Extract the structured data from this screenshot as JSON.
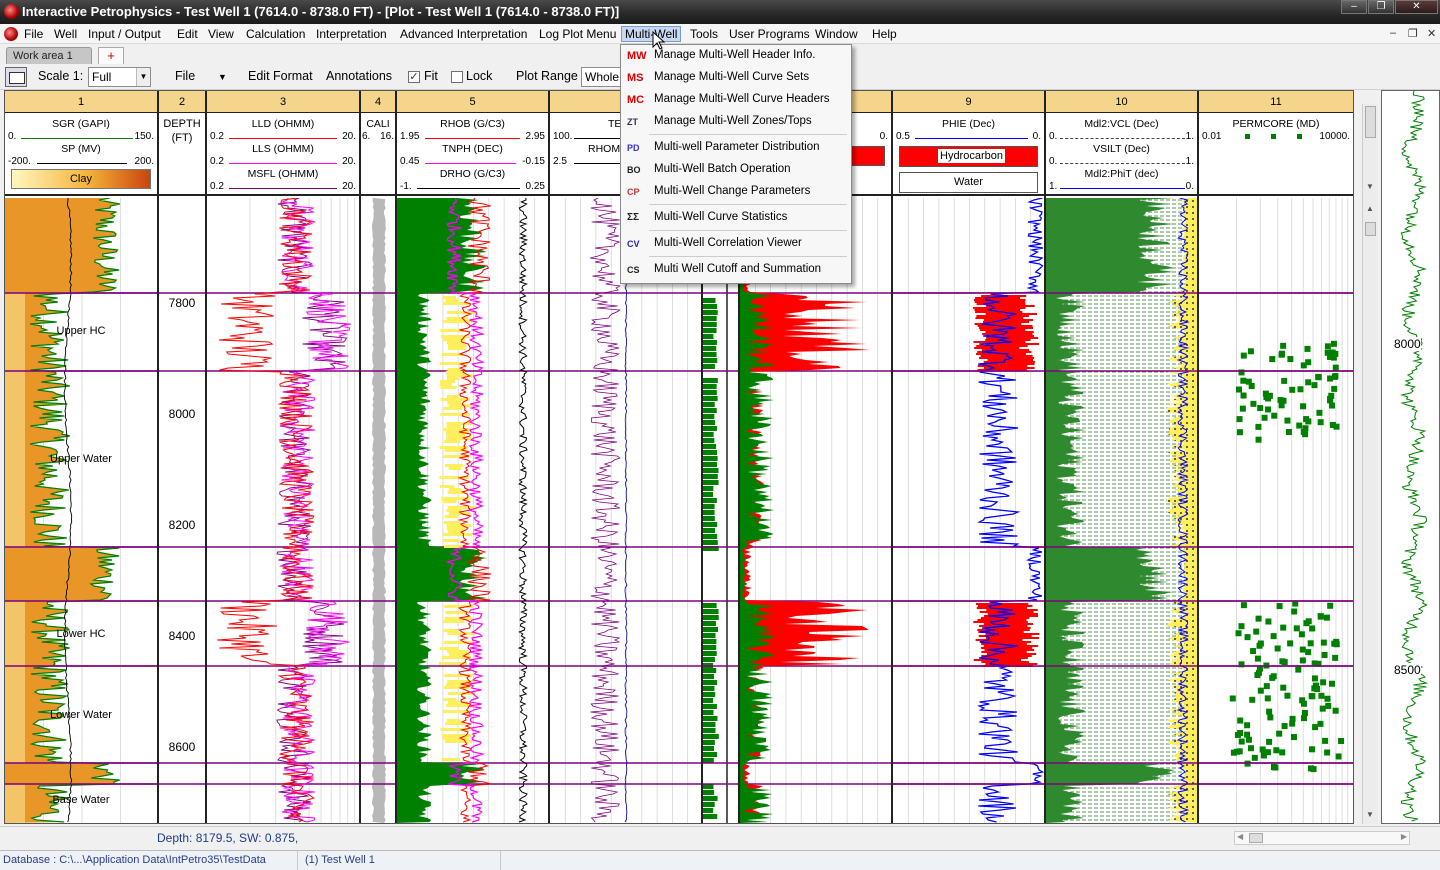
{
  "window": {
    "title": "Interactive Petrophysics  -  Test Well 1 (7614.0 - 8738.0 FT) - [Plot - Test Well 1 (7614.0 - 8738.0 FT)]"
  },
  "menubar": {
    "items": [
      "File",
      "Well",
      "Input / Output",
      "Edit",
      "View",
      "Calculation",
      "Interpretation",
      "Advanced Interpretation",
      "Log Plot Menu",
      "Multi-Well",
      "Tools",
      "User Programs",
      "Window",
      "Help"
    ],
    "active": "Multi-Well"
  },
  "tabs": {
    "work_area": "Work area 1",
    "add": "+"
  },
  "toolbar": {
    "scale_label": "Scale 1:",
    "scale_value": "Full",
    "file": "File",
    "edit_format": "Edit Format",
    "annotations": "Annotations",
    "fit": "Fit",
    "fit_checked": true,
    "lock": "Lock",
    "lock_checked": false,
    "plot_range": "Plot Range",
    "plot_range_value": "Whole"
  },
  "multiwell_menu": [
    {
      "icon": "MW",
      "label": "Manage Multi-Well Header Info."
    },
    {
      "icon": "MS",
      "label": "Manage Multi-Well Curve Sets"
    },
    {
      "icon": "MC",
      "label": "Manage Multi-Well Curve Headers"
    },
    {
      "icon": "ZT",
      "label": "Manage Multi-Well Zones/Tops"
    },
    {
      "icon": "PD",
      "label": "Multi-well Parameter Distribution"
    },
    {
      "icon": "BO",
      "label": "Multi-Well Batch Operation"
    },
    {
      "icon": "CP",
      "label": "Multi-Well Change Parameters"
    },
    {
      "icon": "ΣΣ",
      "label": "Multi-Well Curve Statistics"
    },
    {
      "icon": "CV",
      "label": "Multi-Well Correlation Viewer"
    },
    {
      "icon": "CS",
      "label": "Multi Well Cutoff and Summation"
    }
  ],
  "tracks": {
    "t1": {
      "num": "1",
      "c1": "SGR (GAPI)",
      "c1_min": "0.",
      "c1_max": "150.",
      "c2": "SP (MV)",
      "c2_min": "-200.",
      "c2_max": "200.",
      "fill": "Clay"
    },
    "t2": {
      "num": "2",
      "title1": "DEPTH",
      "title2": "(FT)"
    },
    "t3": {
      "num": "3",
      "c1": "LLD (OHMM)",
      "c1_min": "0.2",
      "c1_max": "20.",
      "c2": "LLS (OHMM)",
      "c2_min": "0.2",
      "c2_max": "20.",
      "c3": "MSFL (OHMM)",
      "c3_min": "0.2",
      "c3_max": "20."
    },
    "t4": {
      "num": "4",
      "c1": "CALI",
      "c1_min": "6.",
      "c1_max": "16."
    },
    "t5": {
      "num": "5",
      "c1": "RHOB (G/C3)",
      "c1_min": "1.95",
      "c1_max": "2.95",
      "c2": "TNPH (DEC)",
      "c2_min": "0.45",
      "c2_max": "-0.15",
      "c3": "DRHO (G/C3)",
      "c3_min": "-1.",
      "c3_max": "0.25"
    },
    "t6": {
      "num": "",
      "c1": "TE",
      "c1_min": "100.",
      "c2": "RHOM",
      "c2_min": "2.5"
    },
    "t7": {
      "num": ""
    },
    "t8": {
      "num": "",
      "c1_max": "0."
    },
    "t9": {
      "num": "9",
      "c1": "PHIE (Dec)",
      "c1_min": "0.5",
      "c1_max": "0.",
      "fill1": "Hydrocarbon",
      "fill2": "Water"
    },
    "t10": {
      "num": "10",
      "c1": "Mdl2:VCL (Dec)",
      "c1_min": "0.",
      "c1_max": "1.",
      "c2": "VSILT (Dec)",
      "c2_min": "0.",
      "c2_max": "1.",
      "c3": "Mdl2:PhiT (dec)",
      "c3_min": "1.",
      "c3_max": "0."
    },
    "t11": {
      "num": "11",
      "c1": "PERMCORE (MD)",
      "c1_min": "0.01",
      "c1_max": "10000."
    }
  },
  "depths": [
    "7800",
    "8000",
    "8200",
    "8400",
    "8600"
  ],
  "zones": [
    "Upper HC",
    "Upper Water",
    "Lower HC",
    "Lower Water",
    "Base Water"
  ],
  "overview_depths": [
    "8000",
    "8500"
  ],
  "depth_readout": "Depth: 8179.5,  SW: 0.875,",
  "status": {
    "database": "Database : C:\\...\\Application Data\\IntPetro35\\TestData",
    "well": "(1) Test Well 1"
  },
  "colors": {
    "shale": "#e8901c",
    "sand": "#ffef5c",
    "hydrocarbon": "#ff0000",
    "green": "#008000",
    "blue": "#0000ff",
    "magenta": "#ff00ff",
    "zone_line": "#800080",
    "header": "#f5d58c"
  }
}
